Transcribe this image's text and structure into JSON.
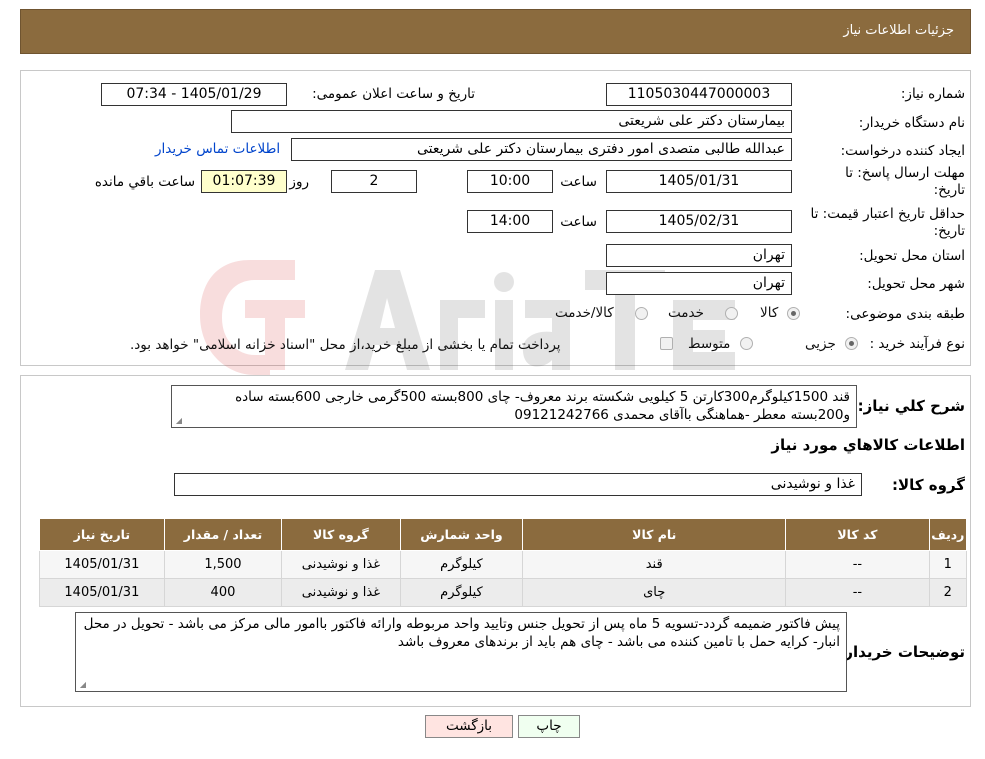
{
  "header": {
    "title": "جزئیات اطلاعات نیاز"
  },
  "form": {
    "need_number_label": "شماره نیاز:",
    "need_number": "1105030447000003",
    "announce_label": "تاریخ و ساعت اعلان عمومی:",
    "announce_value": "1405/01/29 - 07:34",
    "buyer_org_label": "نام دستگاه خریدار:",
    "buyer_org": "بیمارستان دکتر علی شریعتی",
    "creator_label": "ایجاد کننده درخواست:",
    "creator": "عبدالله طالبی متصدی امور دفتری بیمارستان دکتر علی شریعتی",
    "contact_link": "اطلاعات تماس خریدار",
    "deadline_label_1": "مهلت ارسال پاسخ: تا",
    "deadline_label_2": "تاریخ:",
    "deadline_date": "1405/01/31",
    "time_word": "ساعت",
    "deadline_time": "10:00",
    "days_value": "2",
    "days_word": "روز و",
    "remaining_time": "01:07:39",
    "remaining_word": "ساعت باقي مانده",
    "validity_label_1": "حداقل تاریخ اعتبار قیمت: تا",
    "validity_label_2": "تاریخ:",
    "validity_date": "1405/02/31",
    "validity_time": "14:00",
    "province_label": "استان محل تحویل:",
    "province": "تهران",
    "city_label": "شهر محل تحویل:",
    "city": "تهران",
    "category_label": "طبقه بندی موضوعی:",
    "category_options": [
      "کالا",
      "خدمت",
      "کالا/خدمت"
    ],
    "process_label": "نوع فرآیند خرید :",
    "process_options": [
      "جزیی",
      "متوسط"
    ],
    "process_note": "پرداخت تمام یا بخشی از مبلغ خرید،از محل \"اسناد خزانه اسلامی\" خواهد بود."
  },
  "description": {
    "label": "شرح کلي نياز:",
    "text": "قند 1500کیلوگرم300کارتن 5 کیلویی شکسته برند معروف- چای 800بسته 500گرمی خارجی 600بسته ساده و200بسته معطر -هماهنگی باآقای محمدی 09121242766"
  },
  "goods": {
    "title": "اطلاعات کالاهاي مورد نياز",
    "group_label": "گروه کالا:",
    "group_value": "غذا و نوشیدنی"
  },
  "table": {
    "headers": [
      "ردیف",
      "کد کالا",
      "نام کالا",
      "واحد شمارش",
      "گروه کالا",
      "تعداد / مقدار",
      "تاریخ نیاز"
    ],
    "rows": [
      [
        "1",
        "--",
        "قند",
        "کیلوگرم",
        "غذا و نوشیدنی",
        "1,500",
        "1405/01/31"
      ],
      [
        "2",
        "--",
        "چای",
        "کیلوگرم",
        "غذا و نوشیدنی",
        "400",
        "1405/01/31"
      ]
    ]
  },
  "buyer_notes": {
    "label": "توضیحات خریدار:",
    "text": "پیش فاکتور ضمیمه گردد-تسویه 5 ماه پس از تحویل جنس وتایید واحد مربوطه وارائه فاکتور باامور مالی مرکز می باشد - تحویل در محل انبار- کرایه حمل با تامین کننده می باشد - چای هم باید از برندهای معروف باشد"
  },
  "buttons": {
    "print": "چاپ",
    "back": "بازگشت"
  },
  "colors": {
    "header_bg": "#8B6B3E",
    "remaining_bg": "#FFFFCC",
    "back_button_bg": "#FFE4E1",
    "print_button_bg": "#F0FFF0"
  }
}
